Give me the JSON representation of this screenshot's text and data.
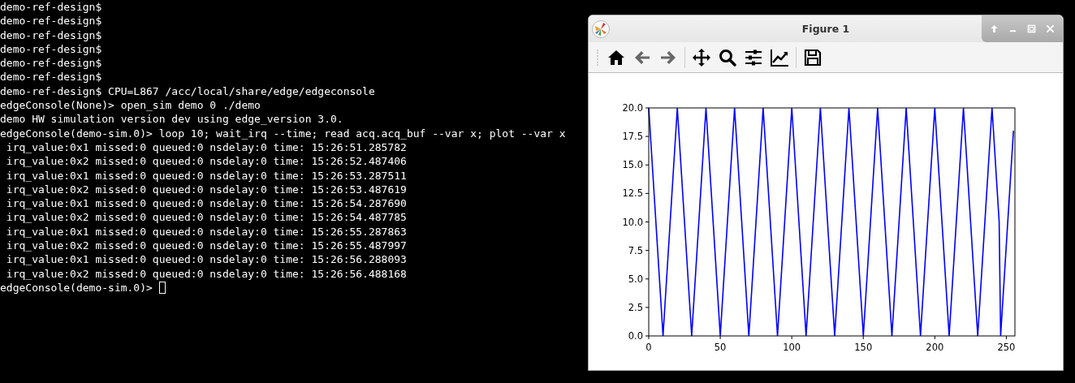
{
  "terminal": {
    "lines": [
      "demo-ref-design$",
      "demo-ref-design$",
      "demo-ref-design$",
      "demo-ref-design$",
      "demo-ref-design$",
      "demo-ref-design$",
      "demo-ref-design$ CPU=L867 /acc/local/share/edge/edgeconsole",
      "edgeConsole(None)> open_sim demo 0 ./demo",
      "demo HW simulation version dev using edge_version 3.0.",
      "edgeConsole(demo-sim.0)> loop 10; wait_irq --time; read acq.acq_buf --var x; plot --var x",
      " irq_value:0x1 missed:0 queued:0 nsdelay:0 time: 15:26:51.285782",
      " irq_value:0x2 missed:0 queued:0 nsdelay:0 time: 15:26:52.487406",
      " irq_value:0x1 missed:0 queued:0 nsdelay:0 time: 15:26:53.287511",
      " irq_value:0x2 missed:0 queued:0 nsdelay:0 time: 15:26:53.487619",
      " irq_value:0x1 missed:0 queued:0 nsdelay:0 time: 15:26:54.287690",
      " irq_value:0x2 missed:0 queued:0 nsdelay:0 time: 15:26:54.487785",
      " irq_value:0x1 missed:0 queued:0 nsdelay:0 time: 15:26:55.287863",
      " irq_value:0x2 missed:0 queued:0 nsdelay:0 time: 15:26:55.487997",
      " irq_value:0x1 missed:0 queued:0 nsdelay:0 time: 15:26:56.288093",
      " irq_value:0x2 missed:0 queued:0 nsdelay:0 time: 15:26:56.488168"
    ],
    "prompt": "edgeConsole(demo-sim.0)>"
  },
  "figure_window": {
    "title": "Figure 1",
    "title_buttons": [
      {
        "kind": "up"
      },
      {
        "kind": "minimize"
      },
      {
        "kind": "maximize"
      },
      {
        "kind": "close"
      }
    ],
    "toolbar": [
      {
        "kind": "home"
      },
      {
        "kind": "back"
      },
      {
        "kind": "forward"
      },
      {
        "kind": "separator"
      },
      {
        "kind": "pan"
      },
      {
        "kind": "zoom"
      },
      {
        "kind": "sliders"
      },
      {
        "kind": "lines"
      },
      {
        "kind": "separator"
      },
      {
        "kind": "save"
      }
    ],
    "chart_data": {
      "type": "line",
      "x": [
        0,
        10,
        20,
        30,
        40,
        50,
        60,
        70,
        80,
        90,
        100,
        110,
        120,
        130,
        140,
        150,
        160,
        170,
        180,
        190,
        200,
        210,
        220,
        230,
        240,
        245,
        246,
        255
      ],
      "series": [
        {
          "color": "#0000ff",
          "values": [
            20,
            0,
            20,
            0,
            20,
            0,
            20,
            0,
            20,
            0,
            20,
            0,
            20,
            0,
            20,
            0,
            20,
            0,
            20,
            0,
            20,
            0,
            20,
            0,
            20,
            10,
            0,
            18
          ]
        }
      ],
      "xlim": [
        0,
        256
      ],
      "ylim": [
        0,
        20
      ],
      "xticks": [
        0,
        50,
        100,
        150,
        200,
        250
      ],
      "yticks": [
        {
          "value": 0,
          "label": "0.0"
        },
        {
          "value": 2.5,
          "label": "2.5"
        },
        {
          "value": 5,
          "label": "5.0"
        },
        {
          "value": 7.5,
          "label": "7.5"
        },
        {
          "value": 10,
          "label": "10.0"
        },
        {
          "value": 12.5,
          "label": "12.5"
        },
        {
          "value": 15,
          "label": "15.0"
        },
        {
          "value": 17.5,
          "label": "17.5"
        },
        {
          "value": 20,
          "label": "20.0"
        }
      ]
    }
  }
}
